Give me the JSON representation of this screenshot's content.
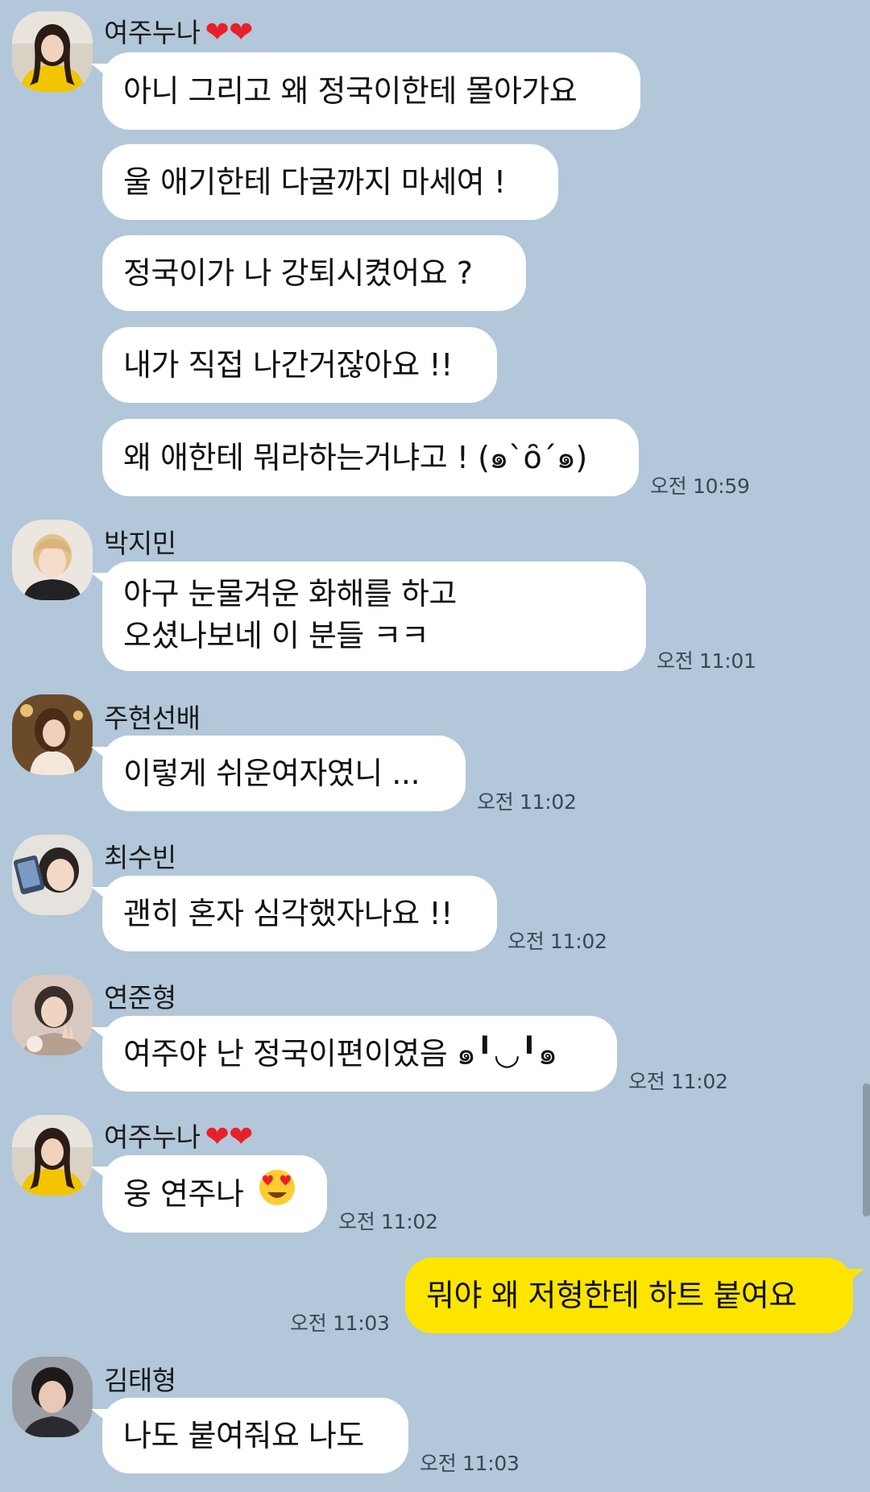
{
  "messages": [
    {
      "sender": "여주누나",
      "sender_hearts": "❤❤",
      "avatar": "avatar-yellow-hoodie",
      "bubbles": [
        "아니 그리고 왜 정국이한테 몰아가요",
        "울 애기한테 다굴까지 마세여 !",
        "정국이가 나 강퇴시켰어요 ?",
        "내가 직접 나간거잖아요 !!",
        "왜 애한테 뭐라하는거냐고 ! (๑`ȏ´๑)"
      ],
      "time": "오전 10:59"
    },
    {
      "sender": "박지민",
      "avatar": "avatar-blonde",
      "bubble_lines": [
        "아구 눈물겨운 화해를 하고",
        "오셨나보네 이 분들 ㅋㅋ"
      ],
      "time": "오전 11:01"
    },
    {
      "sender": "주현선배",
      "avatar": "avatar-brown-hair",
      "bubbles": [
        "이렇게 쉬운여자였니 ..."
      ],
      "time": "오전 11:02"
    },
    {
      "sender": "최수빈",
      "avatar": "avatar-phone",
      "bubbles": [
        "괜히 혼자 심각했자나요 !!"
      ],
      "time": "오전 11:02"
    },
    {
      "sender": "연준형",
      "avatar": "avatar-peace",
      "bubbles": [
        "여주야 난 정국이편이였음 ๑╹◡╹๑"
      ],
      "time": "오전 11:02"
    },
    {
      "sender": "여주누나",
      "sender_hearts": "❤❤",
      "avatar": "avatar-yellow-hoodie",
      "bubbles": [
        "웅 연주나"
      ],
      "emoji": "heart-eyes-face",
      "time": "오전 11:02"
    },
    {
      "mine": true,
      "bubbles": [
        "뭐야 왜 저형한테 하트 붙여요"
      ],
      "time": "오전 11:03"
    },
    {
      "sender": "김태형",
      "avatar": "avatar-dark-hair",
      "bubbles": [
        "나도 붙여줘요 나도"
      ],
      "time": "오전 11:03"
    }
  ],
  "colors": {
    "background": "#b2c7d9",
    "bubble_other": "#ffffff",
    "bubble_mine": "#fee500",
    "heart": "#e8202a"
  }
}
